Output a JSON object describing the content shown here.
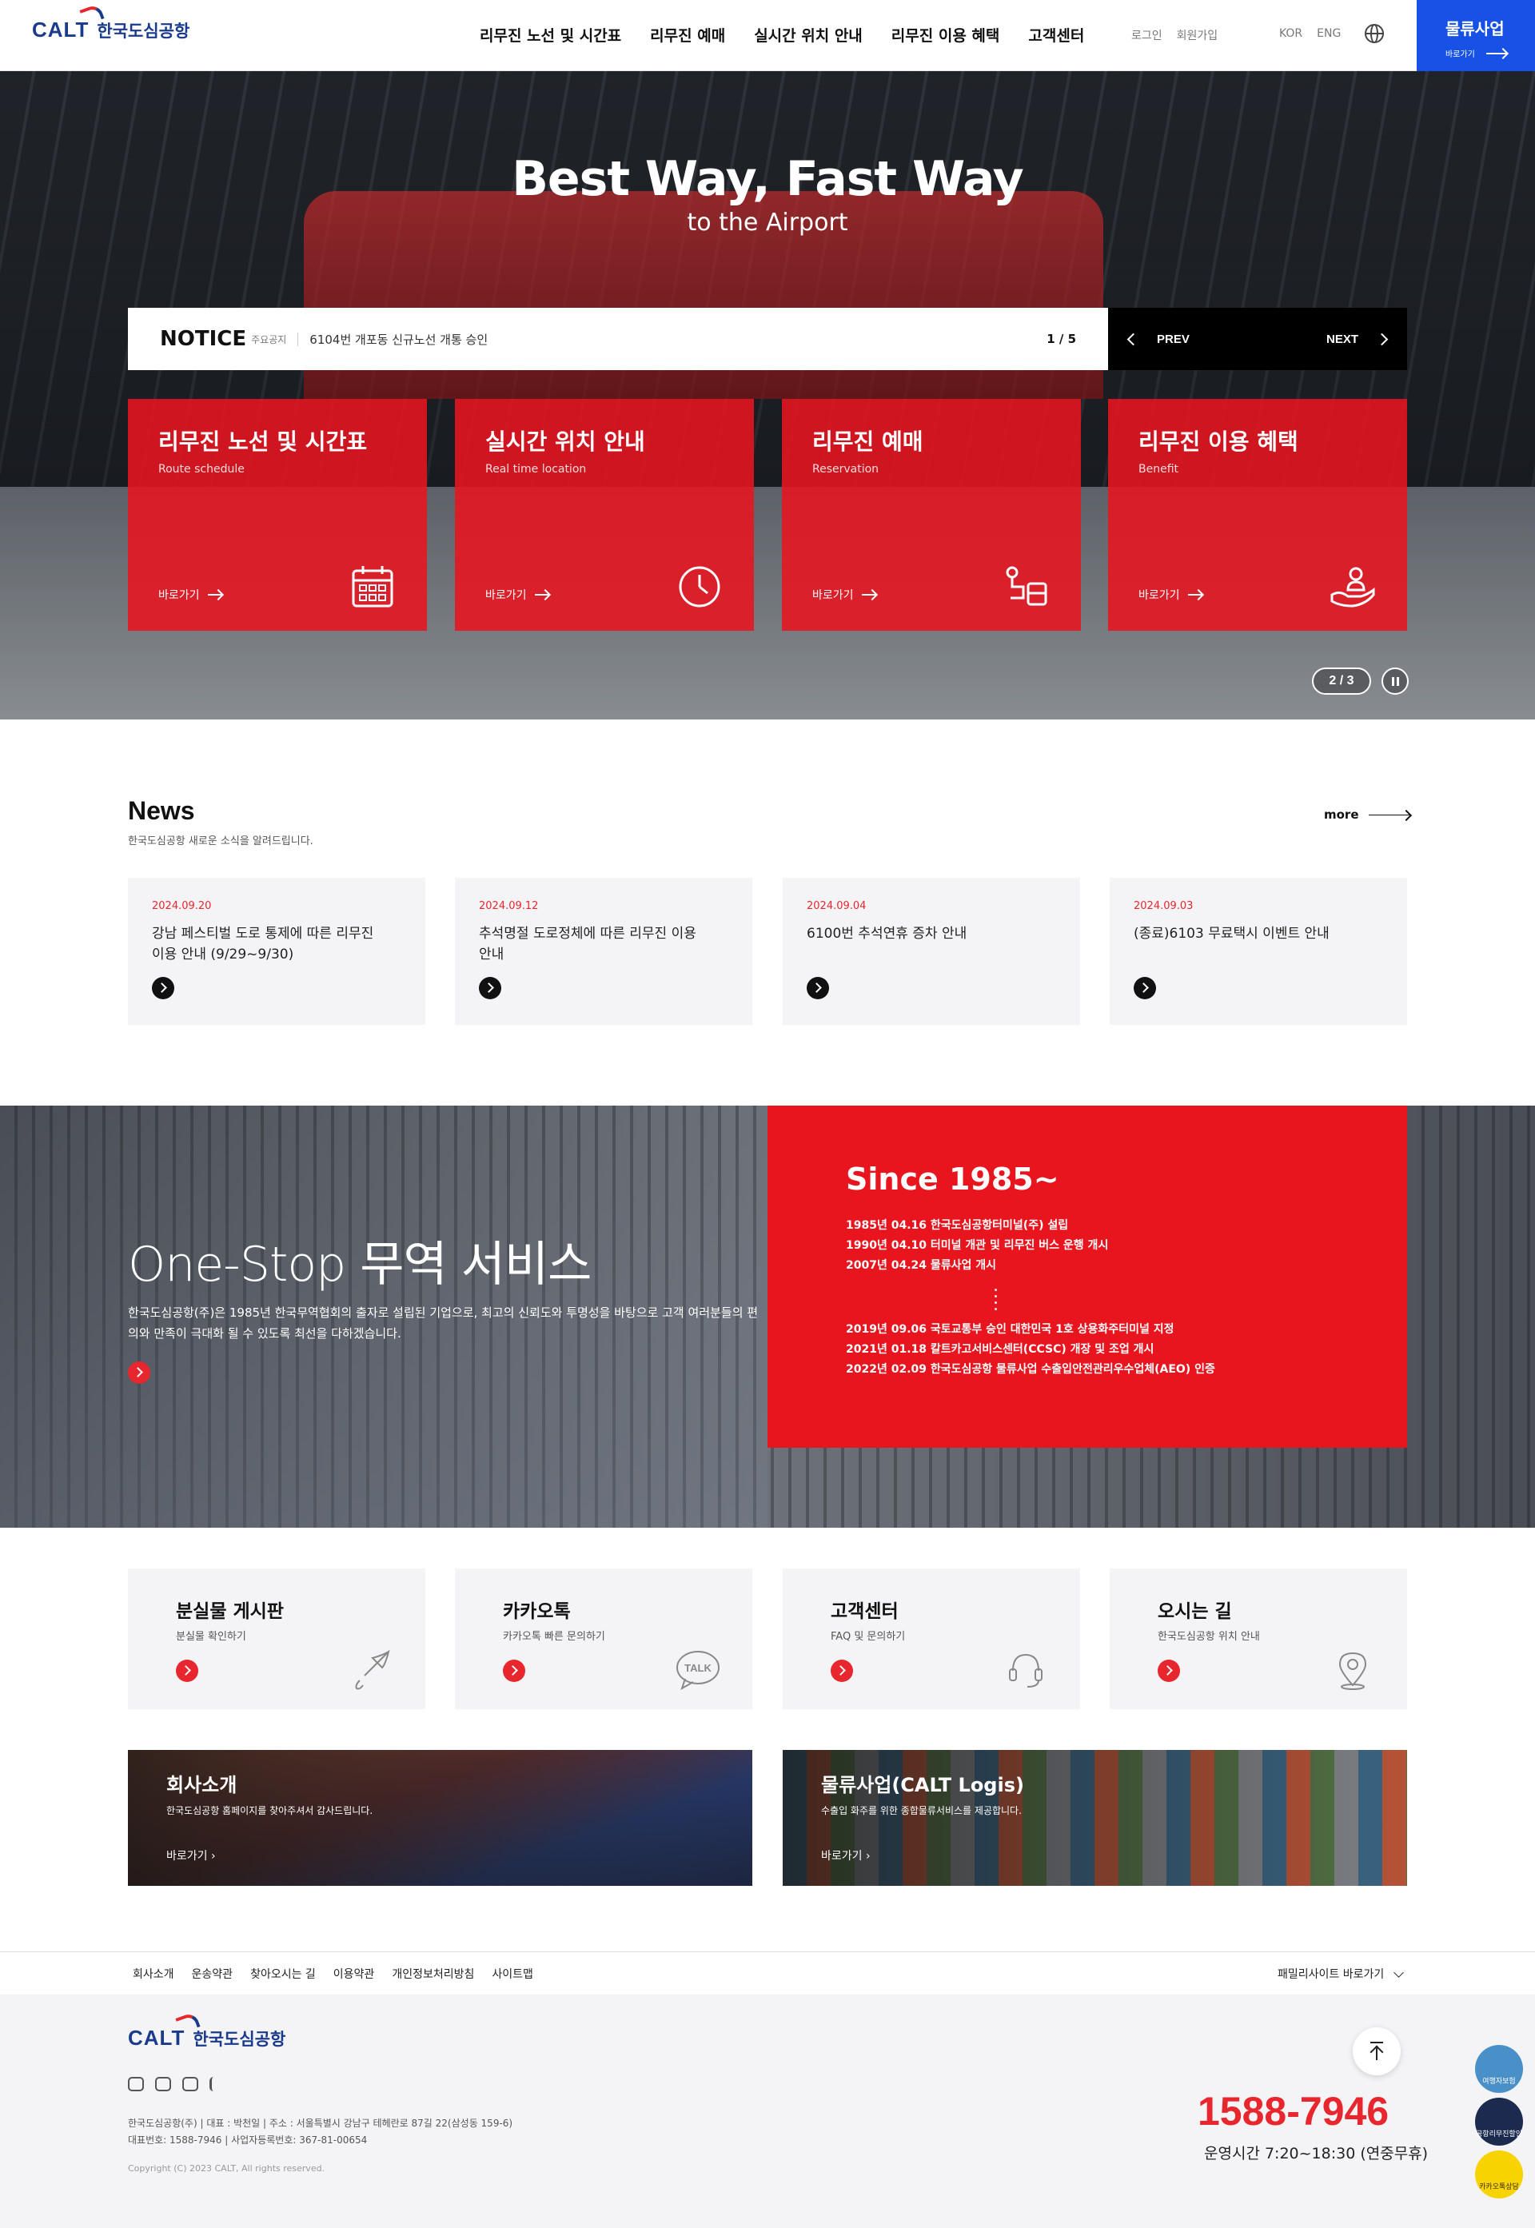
{
  "header": {
    "logo_en": "CALT",
    "logo_ko": "한국도심공항",
    "nav": [
      "리무진 노선 및 시간표",
      "리무진 예매",
      "실시간 위치 안내",
      "리무진 이용 혜택",
      "고객센터"
    ],
    "login": "로그인",
    "join": "회원가입",
    "lang_kor": "KOR",
    "lang_eng": "ENG",
    "logis_title": "물류사업",
    "logis_go": "바로가기"
  },
  "hero": {
    "title": "Best Way, Fast Way",
    "subtitle": "to the Airport",
    "notice_label": "NOTICE",
    "notice_small": "주요공지",
    "notice_text": "6104번 개포동 신규노선 개통 승인",
    "notice_page": "1 / 5",
    "prev": "PREV",
    "next": "NEXT",
    "slide_page": "2 / 3",
    "cards": [
      {
        "title": "리무진 노선 및 시간표",
        "sub": "Route schedule",
        "go": "바로가기"
      },
      {
        "title": "실시간 위치 안내",
        "sub": "Real time location",
        "go": "바로가기"
      },
      {
        "title": "리무진 예매",
        "sub": "Reservation",
        "go": "바로가기"
      },
      {
        "title": "리무진 이용 혜택",
        "sub": "Benefit",
        "go": "바로가기"
      }
    ]
  },
  "news": {
    "title": "News",
    "sub": "한국도심공항 새로운 소식을 알려드립니다.",
    "more": "more",
    "items": [
      {
        "date": "2024.09.20",
        "title": "강남 페스티벌 도로 통제에 따른 리무진 이용 안내 (9/29~9/30)"
      },
      {
        "date": "2024.09.12",
        "title": "추석명절 도로정체에 따른 리무진 이용 안내"
      },
      {
        "date": "2024.09.04",
        "title": "6100번 추석연휴 증차 안내"
      },
      {
        "date": "2024.09.03",
        "title": "(종료)6103 무료택시 이벤트 안내"
      }
    ]
  },
  "onestop": {
    "title": "One-Stop 무역 서비스",
    "desc": "한국도심공항(주)은 1985년 한국무역협회의 출자로 설립된 기업으로, 최고의 신뢰도와 투명성을 바탕으로 고객 여러분들의 편의와 만족이 극대화 될 수 있도록 최선을 다하겠습니다.",
    "since_title": "Since 1985~",
    "history_a": [
      "1985년 04.16 한국도심공항터미널(주) 설립",
      "1990년 04.10 터미널 개관 및 리무진 버스 운행 개시",
      "2007년 04.24 물류사업 개시"
    ],
    "history_b": [
      "2019년 09.06 국토교통부 승인 대한민국 1호 상용화주터미널 지정",
      "2021년 01.18 칼트카고서비스센터(CCSC) 개장 및 조업 개시",
      "2022년 02.09 한국도심공항 물류사업 수출입안전관리우수업체(AEO) 인증"
    ]
  },
  "quick": [
    {
      "title": "분실물 게시판",
      "sub": "분실물 확인하기",
      "icon": "umbrella-icon"
    },
    {
      "title": "카카오톡",
      "sub": "카카오톡 빠른 문의하기",
      "icon": "talk-icon"
    },
    {
      "title": "고객센터",
      "sub": "FAQ 및 문의하기",
      "icon": "headset-icon"
    },
    {
      "title": "오시는 길",
      "sub": "한국도심공항 위치 안내",
      "icon": "location-pin-icon"
    }
  ],
  "banners": [
    {
      "title": "회사소개",
      "sub": "한국도심공항 홈페이지를 찾아주셔서 감사드립니다.",
      "go": "바로가기"
    },
    {
      "title": "물류사업(CALT Logis)",
      "sub": "수출입 화주를 위한 종합물류서비스를 제공합니다.",
      "go": "바로가기"
    }
  ],
  "footer": {
    "links": [
      "회사소개",
      "운송약관",
      "찾아오시는 길",
      "이용약관",
      "개인정보처리방침",
      "사이트맵"
    ],
    "family": "패밀리사이트 바로가기",
    "info1": "한국도심공항(주) | 대표 : 박천일 | 주소 : 서울특별시 강남구 테헤란로 87길 22(삼성동 159-6)",
    "info2": "대표번호: 1588-7946 | 사업자등록번호: 367-81-00654",
    "copy": "Copyright (C) 2023 CALT, All rights reserved.",
    "tel": "1588-7946",
    "hours": "운영시간 7:20~18:30 (연중무휴)",
    "float": [
      "여행자보험",
      "공항리무진할인",
      "카카오톡상담"
    ]
  },
  "colors": {
    "accent": "#e8151f",
    "blue": "#1851e6",
    "navy": "#1a3a8c"
  }
}
